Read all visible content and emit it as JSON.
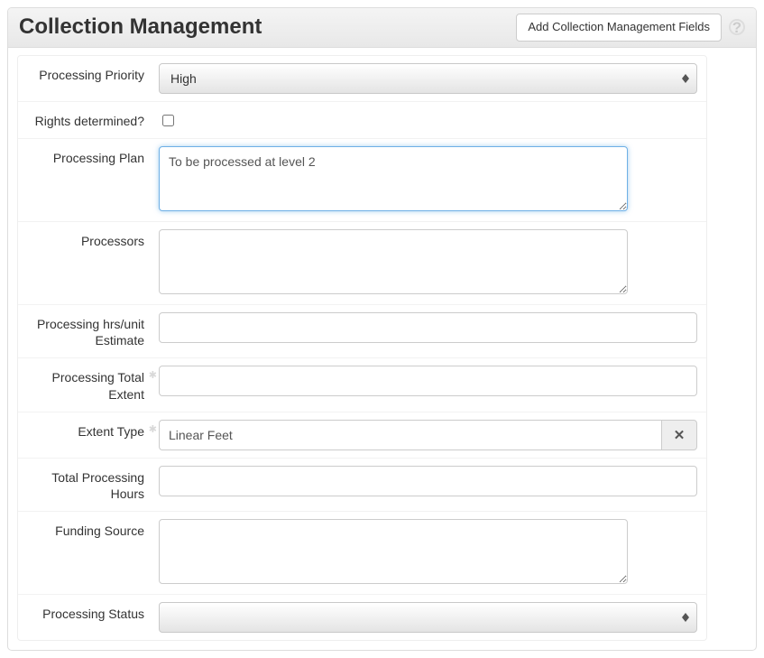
{
  "header": {
    "title": "Collection Management",
    "add_button_label": "Add Collection Management Fields"
  },
  "fields": {
    "processing_priority": {
      "label": "Processing Priority",
      "value": "High"
    },
    "rights_determined": {
      "label": "Rights determined?",
      "checked": false
    },
    "processing_plan": {
      "label": "Processing Plan",
      "value": "To be processed at level 2"
    },
    "processors": {
      "label": "Processors",
      "value": ""
    },
    "processing_hrs_unit_estimate": {
      "label": "Processing hrs/unit Estimate",
      "value": ""
    },
    "processing_total_extent": {
      "label": "Processing Total Extent",
      "value": ""
    },
    "extent_type": {
      "label": "Extent Type",
      "value": "Linear Feet"
    },
    "total_processing_hours": {
      "label": "Total Processing Hours",
      "value": ""
    },
    "funding_source": {
      "label": "Funding Source",
      "value": ""
    },
    "processing_status": {
      "label": "Processing Status",
      "value": ""
    }
  }
}
